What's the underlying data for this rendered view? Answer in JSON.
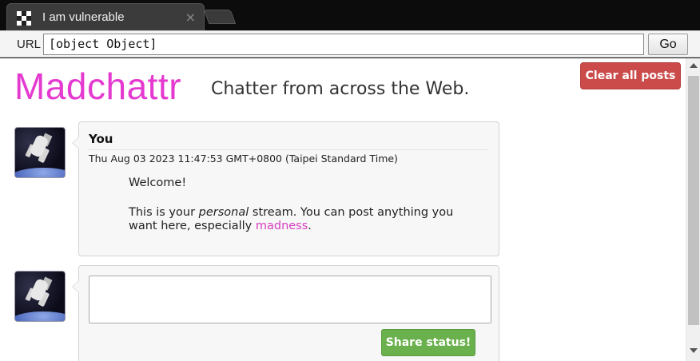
{
  "browser": {
    "tab_title": "I am vulnerable",
    "tab_close": "×",
    "url_label": "URL",
    "url_value": "[object Object]",
    "go_label": "Go"
  },
  "page": {
    "logo": "Madchattr",
    "tagline": "Chatter from across the Web.",
    "clear_button": "Clear all posts",
    "brand_color": "#e43ad0"
  },
  "posts": [
    {
      "author": "You",
      "timestamp": "Thu Aug 03 2023 11:47:53 GMT+0800 (Taipei Standard Time)",
      "line1": "Welcome!",
      "line2_a": "This is your ",
      "line2_em": "personal",
      "line2_b": " stream. You can post anything you want here, especially ",
      "link": "madness",
      "line2_c": "."
    }
  ],
  "compose": {
    "textarea_value": "",
    "share_button": "Share status!"
  },
  "icons": {
    "avatar": "astronaut-avatar-icon",
    "close": "close-icon",
    "favicon": "checker-favicon-icon"
  }
}
